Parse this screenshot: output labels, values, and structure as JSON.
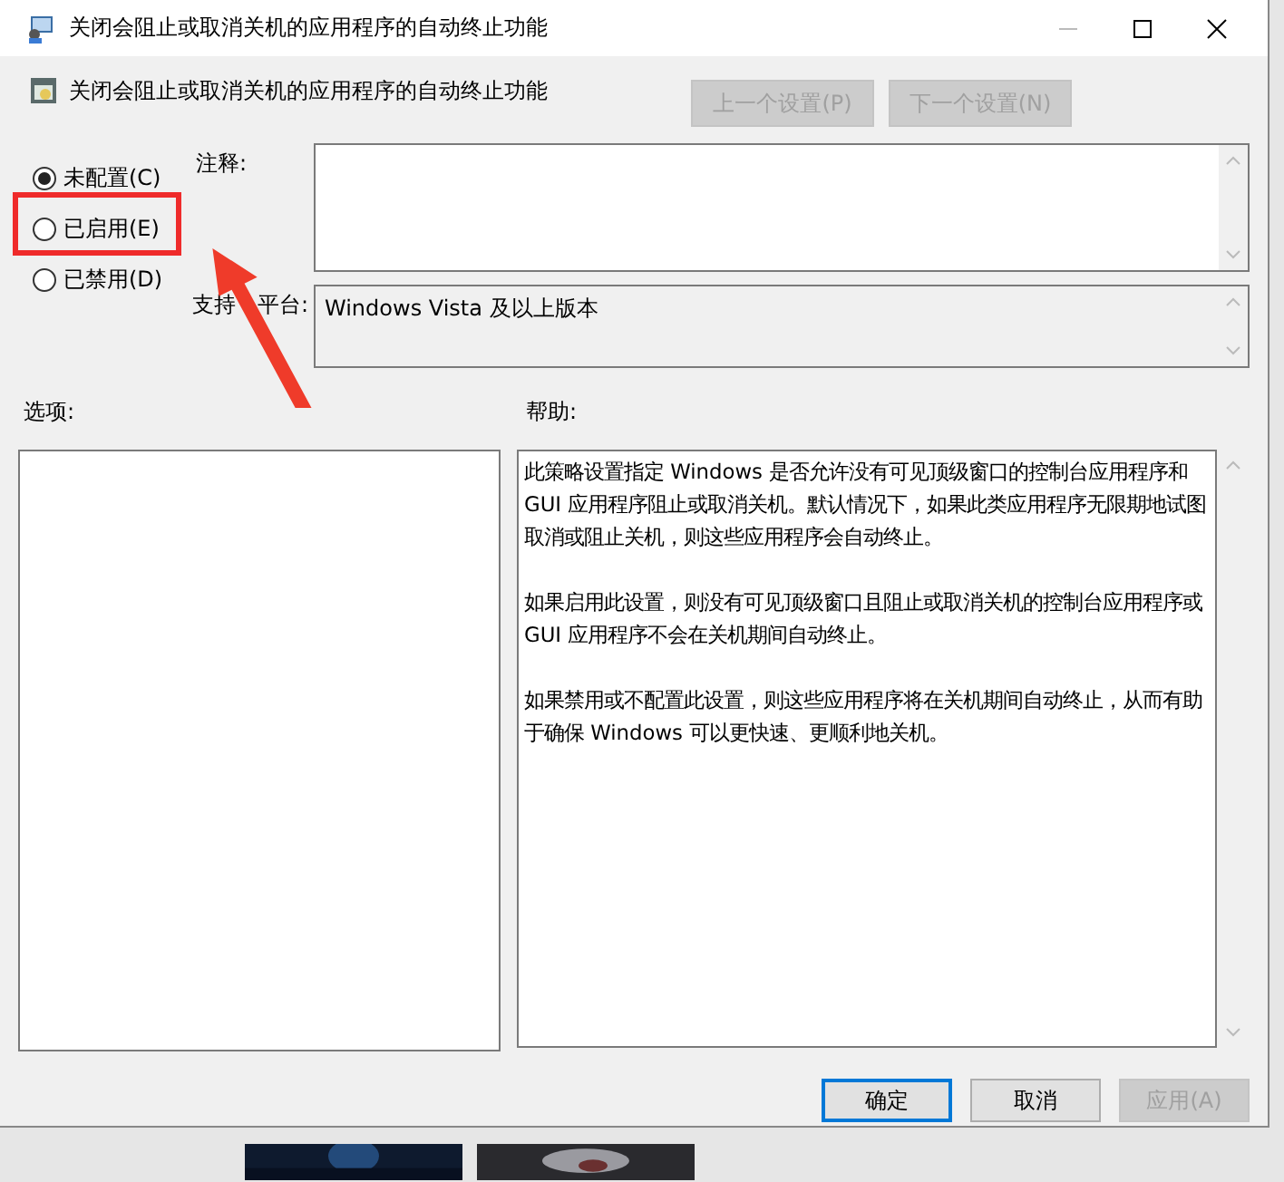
{
  "window": {
    "title": "关闭会阻止或取消关机的应用程序的自动终止功能"
  },
  "header": {
    "title": "关闭会阻止或取消关机的应用程序的自动终止功能",
    "nav_buttons": [
      {
        "label": "上一个设置(P)",
        "disabled": true
      },
      {
        "label": "下一个设置(N)",
        "disabled": true
      }
    ]
  },
  "options": [
    {
      "label": "未配置(C)",
      "selected": true
    },
    {
      "label": "已启用(E)",
      "selected": false
    },
    {
      "label": "已禁用(D)",
      "selected": false
    }
  ],
  "comment": {
    "label": "注释:"
  },
  "platform": {
    "label_parts": [
      "支持",
      "平台:"
    ],
    "value": "Windows Vista 及以上版本"
  },
  "options_label": "选项:",
  "help_label": "帮助:",
  "help": [
    "此策略设置指定 Windows 是否允许没有可见顶级窗口的控制台应用程序和 GUI 应用程序阻止或取消关机。默认情况下，如果此类应用程序无限期地试图取消或阻止关机，则这些应用程序会自动终止。",
    "如果启用此设置，则没有可见顶级窗口且阻止或取消关机的控制台应用程序或 GUI 应用程序不会在关机期间自动终止。",
    "如果禁用或不配置此设置，则这些应用程序将在关机期间自动终止，从而有助于确保 Windows 可以更快速、更顺利地关机。"
  ],
  "buttons": [
    {
      "label": "确定",
      "default": true,
      "disabled": false
    },
    {
      "label": "取消",
      "default": false,
      "disabled": false
    },
    {
      "label": "应用(A)",
      "default": false,
      "disabled": true
    }
  ]
}
